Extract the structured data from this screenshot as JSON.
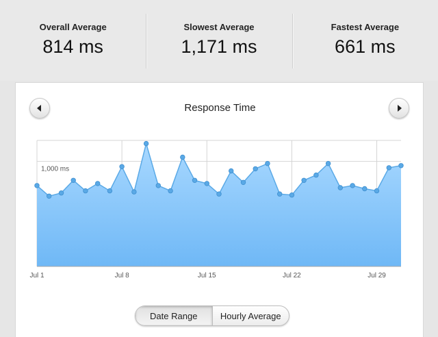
{
  "stats": [
    {
      "label": "Overall Average",
      "value": "814 ms"
    },
    {
      "label": "Slowest Average",
      "value": "1,171 ms"
    },
    {
      "label": "Fastest Average",
      "value": "661 ms"
    }
  ],
  "chart_title": "Response Time",
  "toggle": {
    "date_range": "Date Range",
    "hourly_average": "Hourly Average"
  },
  "colors": {
    "fill_top": "#a8d8ff",
    "fill_bottom": "#6fb8f6",
    "line": "#5aa9e6",
    "point": "#5aa9e6"
  },
  "chart_data": {
    "type": "area",
    "title": "Response Time",
    "xlabel": "",
    "ylabel": "",
    "x": [
      "Jul 1",
      "Jul 2",
      "Jul 3",
      "Jul 4",
      "Jul 5",
      "Jul 6",
      "Jul 7",
      "Jul 8",
      "Jul 9",
      "Jul 10",
      "Jul 11",
      "Jul 12",
      "Jul 13",
      "Jul 14",
      "Jul 15",
      "Jul 16",
      "Jul 17",
      "Jul 18",
      "Jul 19",
      "Jul 20",
      "Jul 21",
      "Jul 22",
      "Jul 23",
      "Jul 24",
      "Jul 25",
      "Jul 26",
      "Jul 27",
      "Jul 28",
      "Jul 29",
      "Jul 30",
      "Jul 31"
    ],
    "x_tick_labels": [
      "Jul 1",
      "Jul 8",
      "Jul 15",
      "Jul 22",
      "Jul 29"
    ],
    "y_tick_labels": [
      "1,000 ms"
    ],
    "series": [
      {
        "values": [
          770,
          670,
          700,
          820,
          720,
          790,
          720,
          950,
          710,
          1170,
          770,
          720,
          1040,
          820,
          790,
          690,
          910,
          800,
          930,
          980,
          690,
          680,
          820,
          870,
          980,
          750,
          770,
          740,
          720,
          940,
          960
        ]
      }
    ],
    "ylim": [
      0,
      1200
    ],
    "grid": true
  }
}
